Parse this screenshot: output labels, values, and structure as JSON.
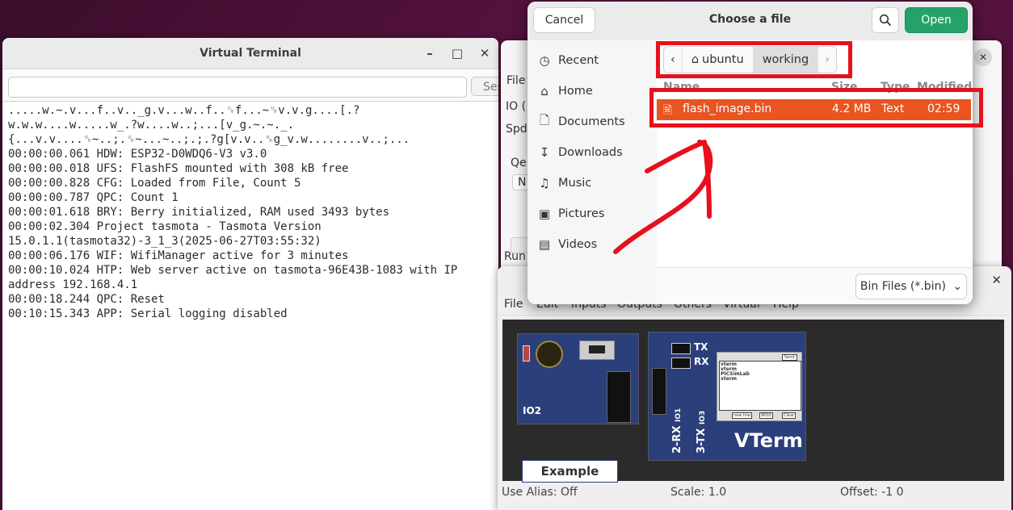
{
  "virtual_terminal": {
    "title": "Virtual Terminal",
    "send_label": "Ser",
    "input_value": "",
    "lines": [
      ".....w.~.v...f..v.._g.v...w..f..␟f...~␟v.v.g....[.?",
      "w.w.w....w.....w_.?w....w..;...[v_g.~.~._.",
      "{...v.v....␟~..;.␟~...~..;.;.?g[v.v..␟g_v.w........v..;...",
      "00:00:00.061 HDW: ESP32-D0WDQ6-V3 v3.0",
      "00:00:00.018 UFS: FlashFS mounted with 308 kB free",
      "00:00:00.828 CFG: Loaded from File, Count 5",
      "00:00:00.787 QPC: Count 1",
      "00:00:01.618 BRY: Berry initialized, RAM used 3493 bytes",
      "00:00:02.304 Project tasmota - Tasmota Version",
      "15.0.1.1(tasmota32)-3_1_3(2025-06-27T03:55:32)",
      "00:00:06.176 WIF: WifiManager active for 3 minutes",
      "00:00:10.024 HTP: Web server active on tasmota-96E43B-1083 with IP",
      "address 192.168.4.1",
      "00:00:18.244 QPC: Reset",
      "00:10:15.343 APP: Serial logging disabled"
    ]
  },
  "background_window": {
    "labels": [
      "File",
      "IO (",
      "Spd",
      "Qe",
      "N",
      "Run"
    ]
  },
  "picsimlab": {
    "menu": [
      "File",
      "Edit",
      "Inputs",
      "Outputs",
      "Others",
      "Virtual",
      "Help"
    ],
    "io_board_label": "IO2",
    "vterm": {
      "tx": "TX",
      "rx": "RX",
      "title": "VTerm",
      "pin1": "2-RX",
      "pin1_sub": "IO1",
      "pin2": "3-TX",
      "pin2_sub": "IO3",
      "screen_send": "Send",
      "screen_lines": [
        "vterm",
        "vterm",
        "PICSimLab",
        "vterm"
      ],
      "screen_newline": "new line",
      "screen_baud": "9600",
      "screen_clear": "Clear"
    },
    "example_label": "Example",
    "status": {
      "alias": "Use Alias: Off",
      "scale": "Scale: 1.0",
      "offset": "Offset:  -1   0"
    }
  },
  "file_chooser": {
    "title": "Choose a file",
    "cancel_label": "Cancel",
    "open_label": "Open",
    "sidebar": [
      {
        "label": "Recent",
        "icon": "clock-icon"
      },
      {
        "label": "Home",
        "icon": "home-icon"
      },
      {
        "label": "Documents",
        "icon": "documents-icon"
      },
      {
        "label": "Downloads",
        "icon": "download-icon"
      },
      {
        "label": "Music",
        "icon": "music-icon"
      },
      {
        "label": "Pictures",
        "icon": "pictures-icon"
      },
      {
        "label": "Videos",
        "icon": "videos-icon"
      }
    ],
    "breadcrumb": [
      "ubuntu",
      "working"
    ],
    "columns": [
      "Name",
      "Size",
      "Type",
      "Modified"
    ],
    "files": [
      {
        "name": "flash_image.bin",
        "size": "4.2 MB",
        "type": "Text",
        "modified": "02:59"
      }
    ],
    "filter": "Bin Files (*.bin)"
  },
  "colors": {
    "accent_open": "#26a269",
    "selection": "#e95420",
    "annotation_red": "#e8101c",
    "board_blue": "#2b3f7a"
  }
}
